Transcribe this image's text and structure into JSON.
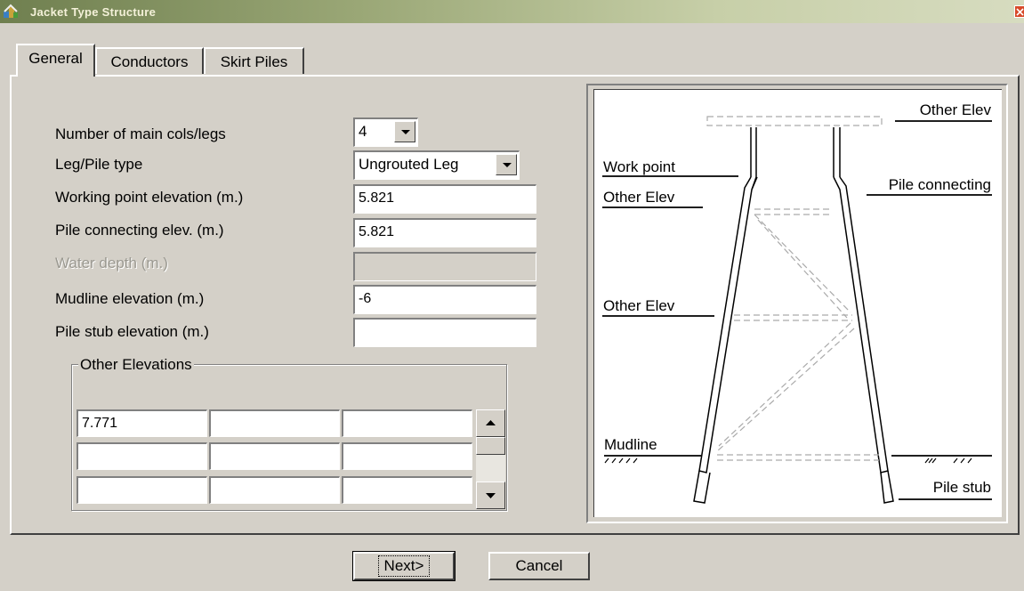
{
  "window": {
    "title": "Jacket Type Structure",
    "title_icon": "structure-app-icon",
    "close_icon": "close-icon"
  },
  "tabs": [
    {
      "label": "General",
      "active": true
    },
    {
      "label": "Conductors",
      "active": false
    },
    {
      "label": "Skirt Piles",
      "active": false
    }
  ],
  "form": {
    "num_legs": {
      "label": "Number of main cols/legs",
      "value": "4"
    },
    "leg_type": {
      "label": "Leg/Pile type",
      "value": "Ungrouted Leg"
    },
    "working_point": {
      "label": "Working point elevation (m.)",
      "value": "5.821"
    },
    "pile_connecting": {
      "label": "Pile connecting elev.  (m.)",
      "value": "5.821"
    },
    "water_depth": {
      "label": "Water depth (m.)",
      "value": "",
      "enabled": false
    },
    "mudline": {
      "label": "Mudline elevation (m.)",
      "value": "-6"
    },
    "pile_stub": {
      "label": "Pile stub elevation   (m.)",
      "value": ""
    }
  },
  "other_elevations": {
    "title": "Other Elevations",
    "cells": [
      [
        "7.771",
        "",
        ""
      ],
      [
        "",
        "",
        ""
      ],
      [
        "",
        "",
        ""
      ]
    ]
  },
  "diagram": {
    "labels": {
      "other_elev_top": "Other Elev",
      "work_point": "Work point",
      "pile_connecting": "Pile connecting",
      "other_elev_1": "Other Elev",
      "other_elev_2": "Other Elev",
      "mudline": "Mudline",
      "pile_stub": "Pile stub"
    }
  },
  "buttons": {
    "next": "Next>",
    "cancel": "Cancel"
  }
}
